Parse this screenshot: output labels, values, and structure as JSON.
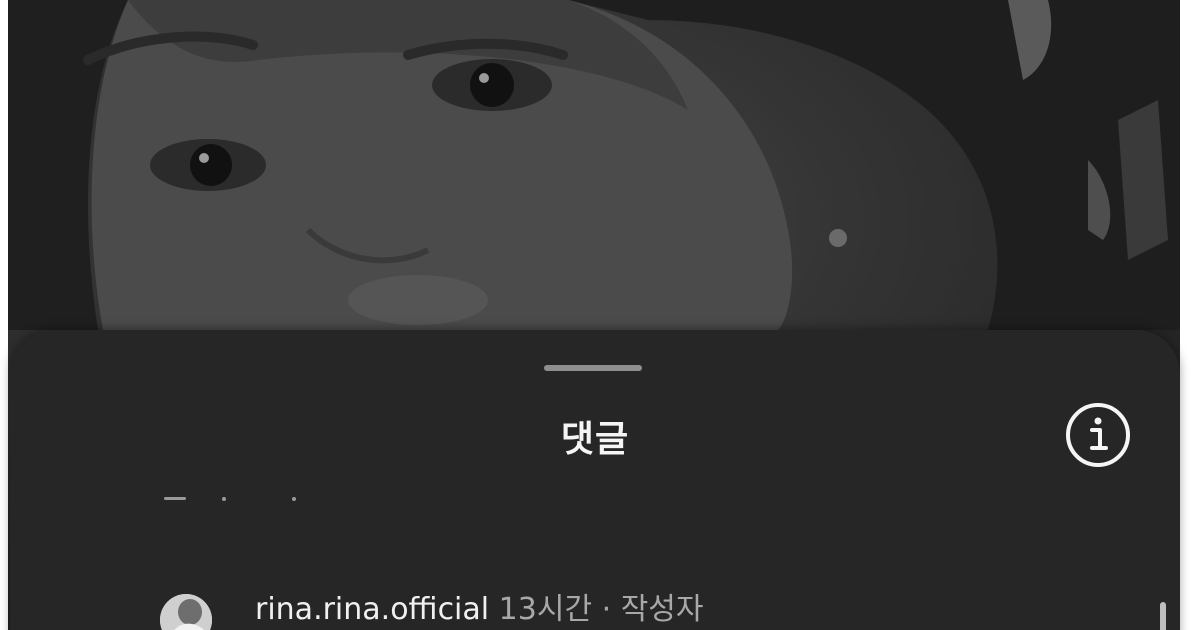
{
  "sheet": {
    "title": "댓글",
    "info_icon": "info-circle-icon"
  },
  "comments": [
    {
      "username": "rina.rina.official",
      "time": "13시간",
      "separator": "·",
      "role": "작성자"
    }
  ],
  "colors": {
    "sheet_background": "#262626",
    "title_text": "#f5f5f5",
    "secondary_text": "#a8a8a8",
    "handle": "#8e8e8e"
  }
}
